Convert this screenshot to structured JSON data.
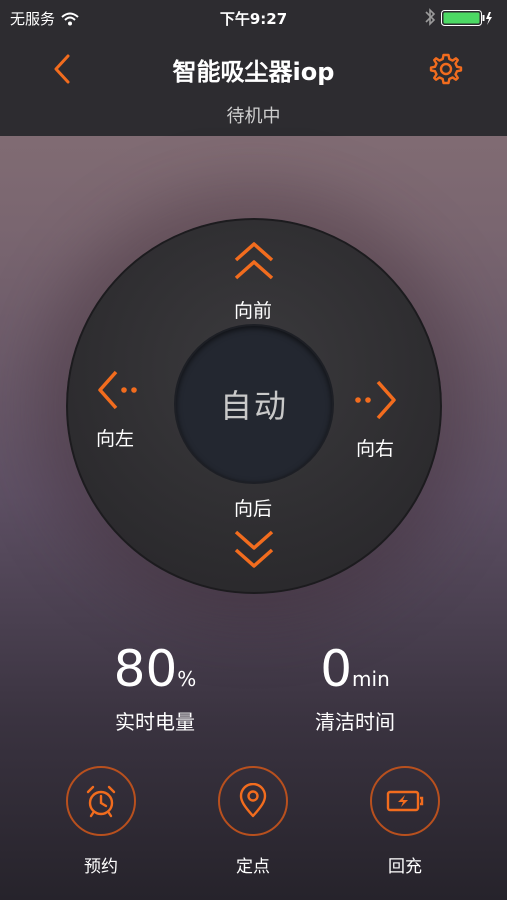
{
  "status_bar": {
    "carrier": "无服务",
    "time": "下午9:27"
  },
  "header": {
    "title": "智能吸尘器iop",
    "subtitle": "待机中"
  },
  "pad": {
    "center_label": "自动",
    "up_label": "向前",
    "down_label": "向后",
    "left_label": "向左",
    "right_label": "向右"
  },
  "stats": {
    "battery_value": "80",
    "battery_unit": "%",
    "battery_label": "实时电量",
    "clean_time_value": "0",
    "clean_time_unit": "min",
    "clean_time_label": "清洁时间"
  },
  "actions": [
    {
      "label": "预约",
      "icon": "alarm-clock-icon"
    },
    {
      "label": "定点",
      "icon": "location-pin-icon"
    },
    {
      "label": "回充",
      "icon": "battery-charge-icon"
    }
  ],
  "colors": {
    "accent": "#f26c1e",
    "topbar": "#2d2c30"
  }
}
